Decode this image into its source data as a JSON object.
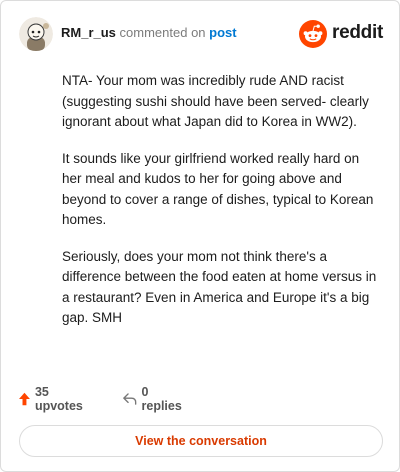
{
  "comment": {
    "username": "RM_r_us",
    "verb": "commented on",
    "target_link": "post",
    "paragraphs": [
      "NTA- Your mom was incredibly rude AND racist (suggesting sushi should have been served- clearly ignorant about what Japan did to Korea in WW2).",
      "It sounds like your girlfriend worked really hard on her meal and kudos to her for going above and beyond to cover a range of dishes, typical to Korean homes.",
      "Seriously, does your mom not think there's a difference between the food eaten at home versus in a restaurant? Even in America and Europe it's a big gap. SMH"
    ]
  },
  "brand": {
    "name": "reddit",
    "color": "#ff4500"
  },
  "actions": {
    "upvotes_label": "35 upvotes",
    "replies_label": "0 replies"
  },
  "cta": {
    "label": "View the conversation"
  },
  "colors": {
    "accent": "#d93a00",
    "link": "#0079d3",
    "upvote": "#ff4500"
  },
  "icons": {
    "avatar": "snoo-avatar-icon",
    "logo": "reddit-logo-icon",
    "upvote": "upvote-arrow-icon",
    "reply": "reply-arrow-icon"
  }
}
